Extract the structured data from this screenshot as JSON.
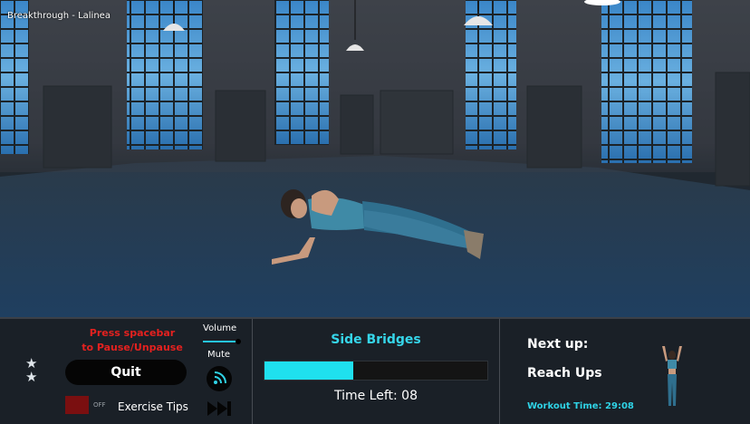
{
  "hud": {
    "song_title": "Breakthrough - Lalinea",
    "pause_hint_line1": "Press spacebar",
    "pause_hint_line2": "to Pause/Unpause",
    "quit_label": "Quit",
    "tips_toggle_state": "OFF",
    "tips_label": "Exercise Tips",
    "volume_label": "Volume",
    "volume_level": 0.9,
    "mute_label": "Mute",
    "exercise_name": "Side Bridges",
    "exercise_progress": 0.4,
    "time_left": "Time Left: 08",
    "next_label": "Next up:",
    "next_exercise": "Reach Ups",
    "workout_time": "Workout Time: 29:08"
  },
  "icons": [
    "star-icon",
    "sound-waves-icon",
    "skip-forward-icon"
  ],
  "colors": {
    "accent_cyan": "#1fe0ee",
    "hint_red": "#e4211f",
    "toggle_off": "#7a0f10",
    "panel_bg": "#1a2027"
  }
}
